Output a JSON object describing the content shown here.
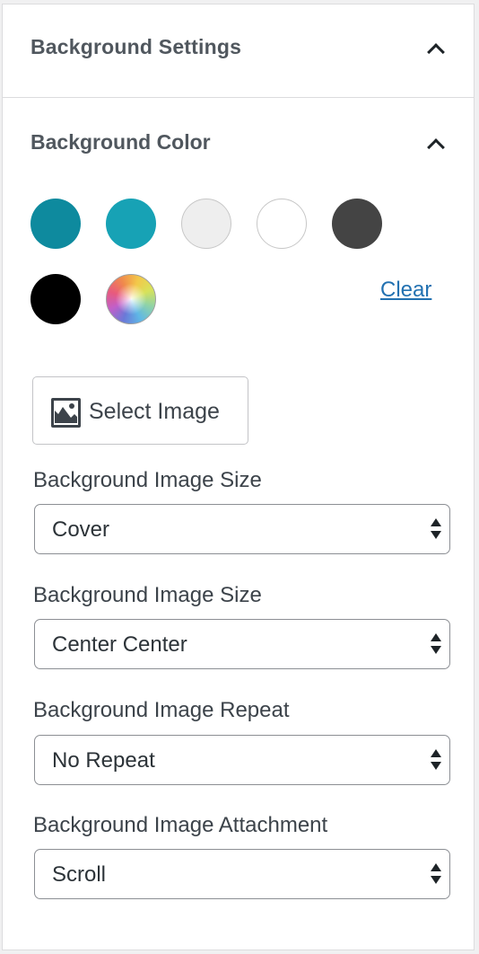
{
  "panel": {
    "section_title": "Background Settings",
    "collapse_icon": "chevron-up-icon"
  },
  "background_color": {
    "title": "Background Color",
    "collapse_icon": "chevron-up-icon",
    "swatches": [
      {
        "name": "dark-teal",
        "color": "#0e8a9e"
      },
      {
        "name": "teal",
        "color": "#17a2b5"
      },
      {
        "name": "light-gray",
        "color": "#eeeeee"
      },
      {
        "name": "white",
        "color": "#ffffff"
      },
      {
        "name": "dark-gray",
        "color": "#444444"
      },
      {
        "name": "black",
        "color": "#000000"
      },
      {
        "name": "custom-color-picker",
        "color": "gradient"
      }
    ],
    "clear_label": "Clear",
    "clear_color": "#2271b1"
  },
  "image": {
    "select_button_label": "Select Image",
    "select_button_icon": "image-icon"
  },
  "fields": [
    {
      "label": "Background Image Size",
      "value": "Cover"
    },
    {
      "label": "Background Image Size",
      "value": "Center Center"
    },
    {
      "label": "Background Image Repeat",
      "value": "No Repeat"
    },
    {
      "label": "Background Image Attachment",
      "value": "Scroll"
    }
  ]
}
